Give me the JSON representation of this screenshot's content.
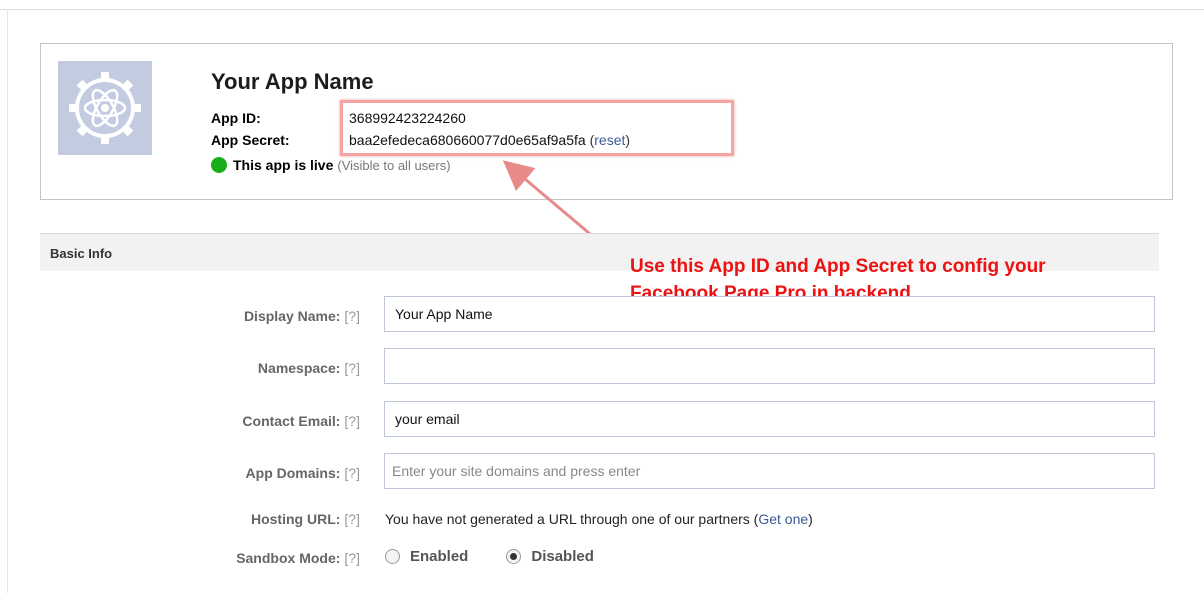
{
  "app": {
    "name": "Your App Name",
    "app_id_label": "App ID:",
    "app_id": "368992423224260",
    "app_secret_label": "App Secret:",
    "app_secret": "baa2efedeca680660077d0e65af9a5fa",
    "reset_prefix": "(",
    "reset_link": "reset",
    "reset_suffix": ")",
    "live_text": "This app is live",
    "live_sub": "(Visible to all users)",
    "logo_icon": "atom-gear-icon",
    "live_color": "#1aad1a"
  },
  "annotation": {
    "line1": "Use this App ID and App Secret to config your",
    "line2": "Facebook Page Pro in backend.",
    "color": "#ee1111"
  },
  "section": {
    "title": "Basic Info"
  },
  "form": {
    "help": "[?]",
    "display_name": {
      "label": "Display Name:",
      "value": "Your App Name"
    },
    "namespace": {
      "label": "Namespace:",
      "value": ""
    },
    "contact_email": {
      "label": "Contact Email:",
      "value": "your email"
    },
    "app_domains": {
      "label": "App Domains:",
      "placeholder": "Enter your site domains and press enter"
    },
    "hosting_url": {
      "label": "Hosting URL:",
      "text": "You have not generated a URL through one of our partners",
      "link_prefix": "(",
      "link": "Get one",
      "link_suffix": ")"
    },
    "sandbox_mode": {
      "label": "Sandbox Mode:",
      "options": [
        "Enabled",
        "Disabled"
      ],
      "selected": "Disabled"
    }
  }
}
